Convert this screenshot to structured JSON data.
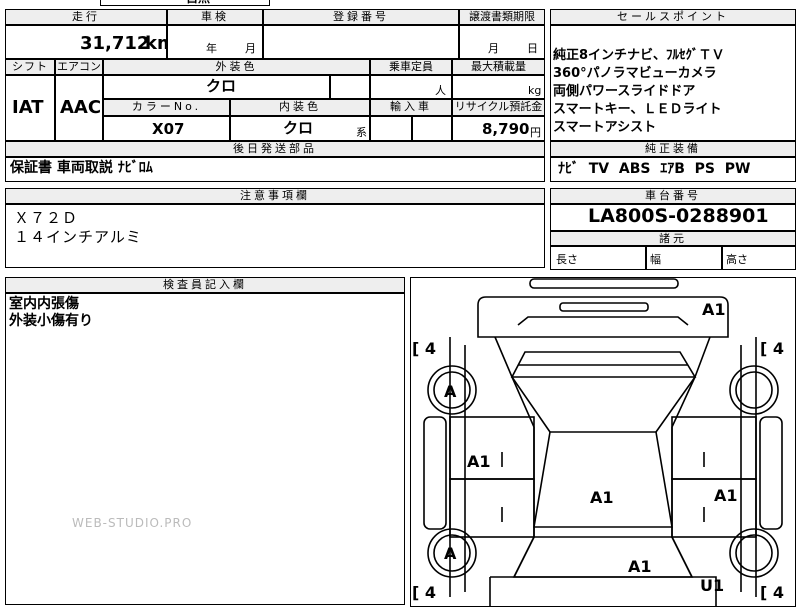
{
  "top_fragment": "自然",
  "header": {
    "mileage_label": "走行",
    "shaken_label": "車検",
    "reg_no_label": "登録番号",
    "transfer_label": "譲渡書類期限",
    "sales_point_label": "セールスポイント"
  },
  "mileage": {
    "value": "31,712",
    "unit": "km"
  },
  "shaken": {
    "year": "年",
    "month": "月"
  },
  "transfer": {
    "month": "月",
    "day": "日"
  },
  "sales_points": [
    "純正8インチナビ、ﾌﾙｾｸﾞＴＶ",
    "360°パノラマビューカメラ",
    "両側パワースライドドア",
    "スマートキー、ＬＥＤライト",
    "スマートアシスト"
  ],
  "row2_labels": {
    "shift": "シフト",
    "aircon": "エアコン",
    "exterior_color": "外装色",
    "capacity": "乗車定員",
    "max_load": "最大積載量"
  },
  "shift": "IAT",
  "aircon": "AAC",
  "exterior_color": "クロ",
  "capacity_unit": "人",
  "load_unit": "kg",
  "row3_labels": {
    "color_no": "カラーNo.",
    "interior_color": "内装色",
    "import": "輸入車",
    "recycle": "リサイクル預託金"
  },
  "color_no": "X07",
  "interior_color": "クロ",
  "interior_suffix": "系",
  "recycle_fee": {
    "value": "8,790",
    "unit": "円"
  },
  "rear_parts_label": "後日発送部品",
  "rear_parts": "保証書 車両取説 ﾅﾋﾞﾛﾑ",
  "equipment_label": "純正装備",
  "equipment": "ﾅﾋﾞ  TV  ABS  ｴｱB  PS  PW",
  "notes_label": "注意事項欄",
  "notes": [
    "Ｘ７２Ｄ",
    "１４インチアルミ"
  ],
  "chassis_label": "車台番号",
  "chassis_no": "LA800S-0288901",
  "dimensions_label": "諸元",
  "dimensions": {
    "length": "長さ",
    "width": "幅",
    "height": "高さ"
  },
  "inspector_label": "検査員記入欄",
  "inspector_notes": [
    "室内内張傷",
    "外装小傷有り"
  ],
  "tire_marks": [
    "[ 4",
    "[ 4",
    "[ 4",
    "[ 4"
  ],
  "damage_marks": {
    "front_right": "A1",
    "front_left_wheel": "A",
    "rear_left_wheel": "A",
    "left_door": "A1",
    "roof": "A1",
    "right_door": "A1",
    "rear": "A1",
    "rear_right": "U1"
  },
  "watermark": "WEB-STUDIO.PRO"
}
